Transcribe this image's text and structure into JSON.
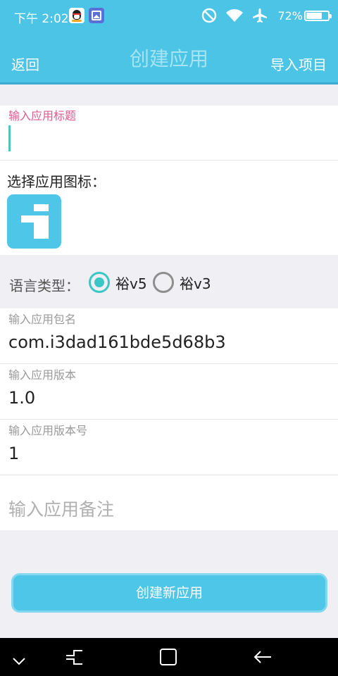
{
  "status_bar": {
    "time": "下午 2:02",
    "battery": "72%",
    "app_icons": [
      "qq-icon",
      "gallery-icon"
    ],
    "system_icons": [
      "do-not-disturb-icon",
      "wifi-icon",
      "airplane-icon",
      "battery-icon"
    ]
  },
  "title_bar": {
    "back": "返回",
    "title": "创建应用",
    "import": "导入项目"
  },
  "form": {
    "title_field": {
      "label": "输入应用标题",
      "value": ""
    },
    "icon_label": "选择应用图标：",
    "language": {
      "label": "语言类型：",
      "options": [
        {
          "label": "裕v5",
          "checked": true
        },
        {
          "label": "裕v3",
          "checked": false
        }
      ]
    },
    "package_field": {
      "label": "输入应用包名",
      "value": "com.i3dad161bde5d68b3"
    },
    "version_field": {
      "label": "输入应用版本",
      "value": "1.0"
    },
    "version_code_field": {
      "label": "输入应用版本号",
      "value": "1"
    },
    "remarks_field": {
      "placeholder": "输入应用备注",
      "value": ""
    }
  },
  "create_button": "创建新应用",
  "nav_bar": {
    "buttons": [
      "chevron-down-icon",
      "recent-apps-icon",
      "home-icon",
      "back-arrow-icon"
    ]
  },
  "colors": {
    "primary": "#4cc4e6",
    "accent": "#3cc7c7",
    "focus_label": "#e05a8f",
    "background": "#efeff4"
  }
}
